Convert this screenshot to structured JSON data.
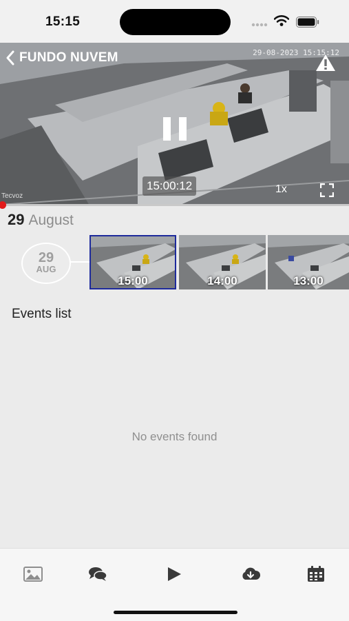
{
  "status_bar": {
    "time": "15:15"
  },
  "player": {
    "camera_name": "FUNDO NUVEM",
    "overlay_timestamp": "29-08-2023 15:15:12",
    "watermark": "Tecvoz",
    "current_time": "15:00:12",
    "speed": "1x",
    "progress": 0.0,
    "icons": [
      "chevron-left-icon",
      "warning-icon",
      "pause-icon",
      "fullscreen-icon"
    ]
  },
  "date_header": {
    "day": "29",
    "month": "August"
  },
  "timeline": {
    "day_badge": {
      "day": "29",
      "month": "AUG"
    },
    "thumbnails": [
      {
        "label": "15:00",
        "selected": true
      },
      {
        "label": "14:00",
        "selected": false
      },
      {
        "label": "13:00",
        "selected": false
      }
    ]
  },
  "events": {
    "title": "Events list",
    "empty_text": "No events found"
  },
  "tab_bar": {
    "tabs": [
      {
        "icon": "image-icon"
      },
      {
        "icon": "chat-icon"
      },
      {
        "icon": "play-icon"
      },
      {
        "icon": "cloud-download-icon"
      },
      {
        "icon": "calendar-icon"
      }
    ]
  },
  "colors": {
    "accent": "#1d2a9c",
    "progress_dot": "#e21a1a",
    "background": "#ebebeb"
  }
}
